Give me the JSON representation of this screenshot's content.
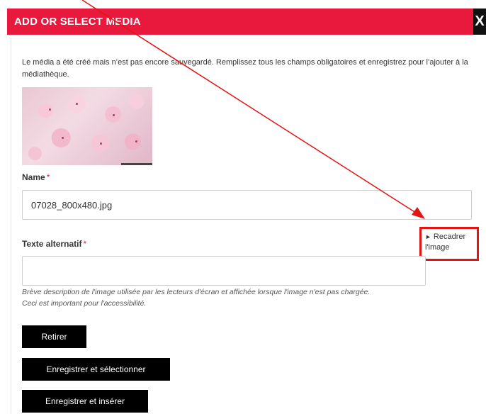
{
  "header": {
    "title": "ADD OR SELECT MEDIA",
    "close_glyph": "X"
  },
  "notice": "Le média a été créé mais n’est pas encore sauvegardé. Remplissez tous les champs obligatoires et enregistrez pour l’ajouter à la médiathèque.",
  "name_field": {
    "label": "Name",
    "required_mark": "*",
    "value": "07028_800x480.jpg"
  },
  "recadrer": {
    "arrow": "►",
    "line1": "Recadrer",
    "line2": "l'image"
  },
  "alt_field": {
    "label": "Texte alternatif",
    "required_mark": "*",
    "value": "",
    "help_line1": "Brève description de l'image utilisée par les lecteurs d'écran et affichée lorsque l'image n'est pas chargée.",
    "help_line2": "Ceci est important pour l'accessibilité."
  },
  "buttons": {
    "remove": "Retirer",
    "save_select": "Enregistrer et sélectionner",
    "save_insert": "Enregistrer et insérer"
  },
  "colors": {
    "header_bg": "#e8193c",
    "annotation": "#e31414",
    "button_bg": "#000000"
  }
}
